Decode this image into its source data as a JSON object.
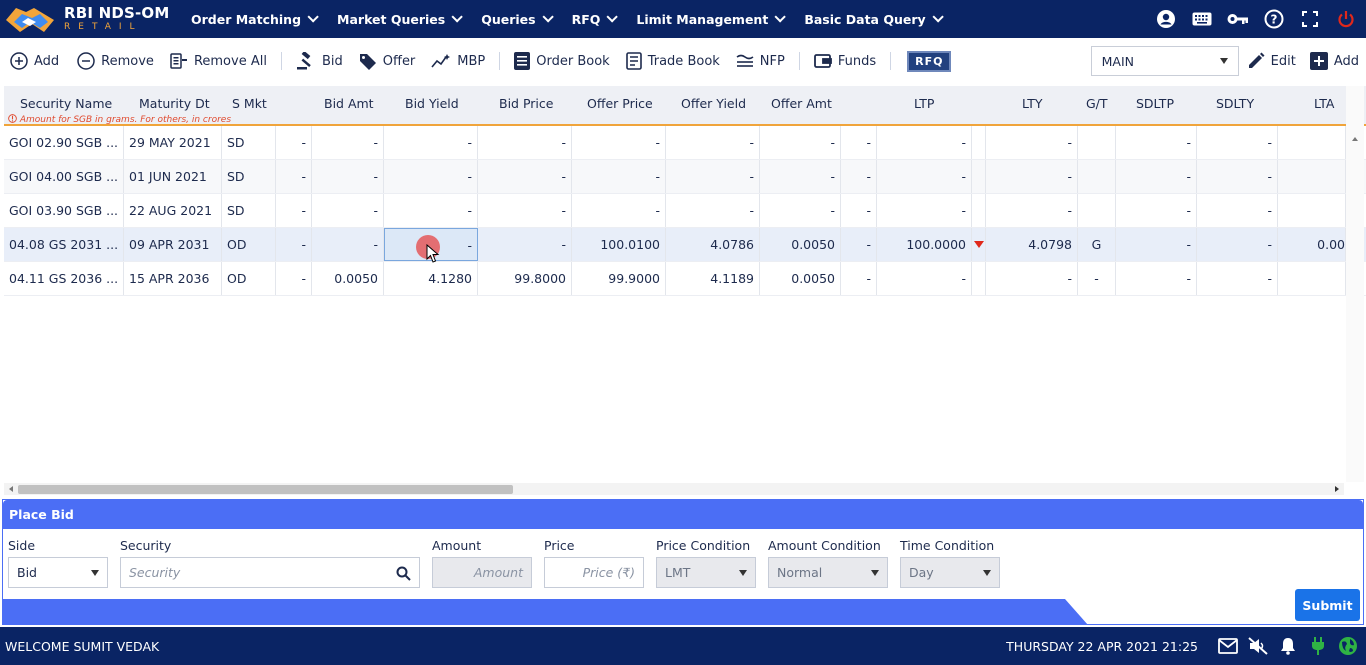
{
  "app": {
    "title": "RBI NDS-OM",
    "subtitle": "RETAIL"
  },
  "nav": [
    {
      "label": "Order Matching"
    },
    {
      "label": "Market Queries"
    },
    {
      "label": "Queries"
    },
    {
      "label": "RFQ"
    },
    {
      "label": "Limit Management"
    },
    {
      "label": "Basic Data Query"
    }
  ],
  "toolbar": {
    "add": "Add",
    "remove": "Remove",
    "remove_all": "Remove All",
    "bid": "Bid",
    "offer": "Offer",
    "mbp": "MBP",
    "order_book": "Order Book",
    "trade_book": "Trade Book",
    "nfp": "NFP",
    "funds": "Funds",
    "rfq": "RFQ",
    "watchlist": "MAIN",
    "edit": "Edit",
    "add2": "Add"
  },
  "grid": {
    "columns": [
      "Security Name",
      "Maturity Dt",
      "S Mkt",
      "Bid Amt",
      "Bid Yield",
      "Bid Price",
      "Offer Price",
      "Offer Yield",
      "Offer Amt",
      "LTP",
      "LTY",
      "G/T",
      "SDLTP",
      "SDLTY",
      "LTA"
    ],
    "note": "Amount for SGB in grams. For others, in crores",
    "rows": [
      {
        "name": "GOI 02.90 SGB ...",
        "maturity": "29 MAY 2021",
        "smkt": "SD",
        "c1": "-",
        "bid_amt": "-",
        "bid_yield": "-",
        "bid_price": "-",
        "offer_price": "-",
        "offer_yield": "-",
        "offer_amt": "-",
        "c2": "-",
        "ltp": "-",
        "lty": "-",
        "gt": "",
        "sdltp": "-",
        "sdlty": "-",
        "lta": ""
      },
      {
        "name": "GOI 04.00 SGB ...",
        "maturity": "01 JUN 2021",
        "smkt": "SD",
        "c1": "-",
        "bid_amt": "-",
        "bid_yield": "-",
        "bid_price": "-",
        "offer_price": "-",
        "offer_yield": "-",
        "offer_amt": "-",
        "c2": "-",
        "ltp": "-",
        "lty": "-",
        "gt": "",
        "sdltp": "-",
        "sdlty": "-",
        "lta": ""
      },
      {
        "name": "GOI 03.90 SGB ...",
        "maturity": "22 AUG 2021",
        "smkt": "SD",
        "c1": "-",
        "bid_amt": "-",
        "bid_yield": "-",
        "bid_price": "-",
        "offer_price": "-",
        "offer_yield": "-",
        "offer_amt": "-",
        "c2": "-",
        "ltp": "-",
        "lty": "-",
        "gt": "",
        "sdltp": "-",
        "sdlty": "-",
        "lta": ""
      },
      {
        "name": "04.08 GS 2031 ...",
        "maturity": "09 APR 2031",
        "smkt": "OD",
        "c1": "-",
        "bid_amt": "-",
        "bid_yield": "-",
        "bid_price": "-",
        "offer_price": "100.0100",
        "offer_yield": "4.0786",
        "offer_amt": "0.0050",
        "c2": "-",
        "ltp": "100.0000",
        "lty": "4.0798",
        "gt": "G",
        "sdltp": "-",
        "sdlty": "-",
        "lta": "0.00"
      },
      {
        "name": "04.11 GS 2036 ...",
        "maturity": "15 APR 2036",
        "smkt": "OD",
        "c1": "-",
        "bid_amt": "0.0050",
        "bid_yield": "4.1280",
        "bid_price": "99.8000",
        "offer_price": "99.9000",
        "offer_yield": "4.1189",
        "offer_amt": "0.0050",
        "c2": "-",
        "ltp": "-",
        "lty": "-",
        "gt": "-",
        "sdltp": "-",
        "sdlty": "-",
        "lta": ""
      }
    ]
  },
  "place_bid": {
    "title": "Place Bid",
    "side_label": "Side",
    "side_value": "Bid",
    "security_label": "Security",
    "security_placeholder": "Security",
    "amount_label": "Amount",
    "amount_placeholder": "Amount",
    "price_label": "Price",
    "price_placeholder": "Price (₹)",
    "price_cond_label": "Price Condition",
    "price_cond_value": "LMT",
    "amount_cond_label": "Amount Condition",
    "amount_cond_value": "Normal",
    "time_cond_label": "Time Condition",
    "time_cond_value": "Day",
    "submit": "Submit"
  },
  "footer": {
    "welcome": "WELCOME SUMIT VEDAK",
    "datetime": "THURSDAY 22 APR 2021 21:25"
  },
  "colors": {
    "navy": "#0a2464",
    "accent": "#4b6ef5",
    "orange": "#f0a43a",
    "down": "#e0281b",
    "online": "#2fb344"
  }
}
